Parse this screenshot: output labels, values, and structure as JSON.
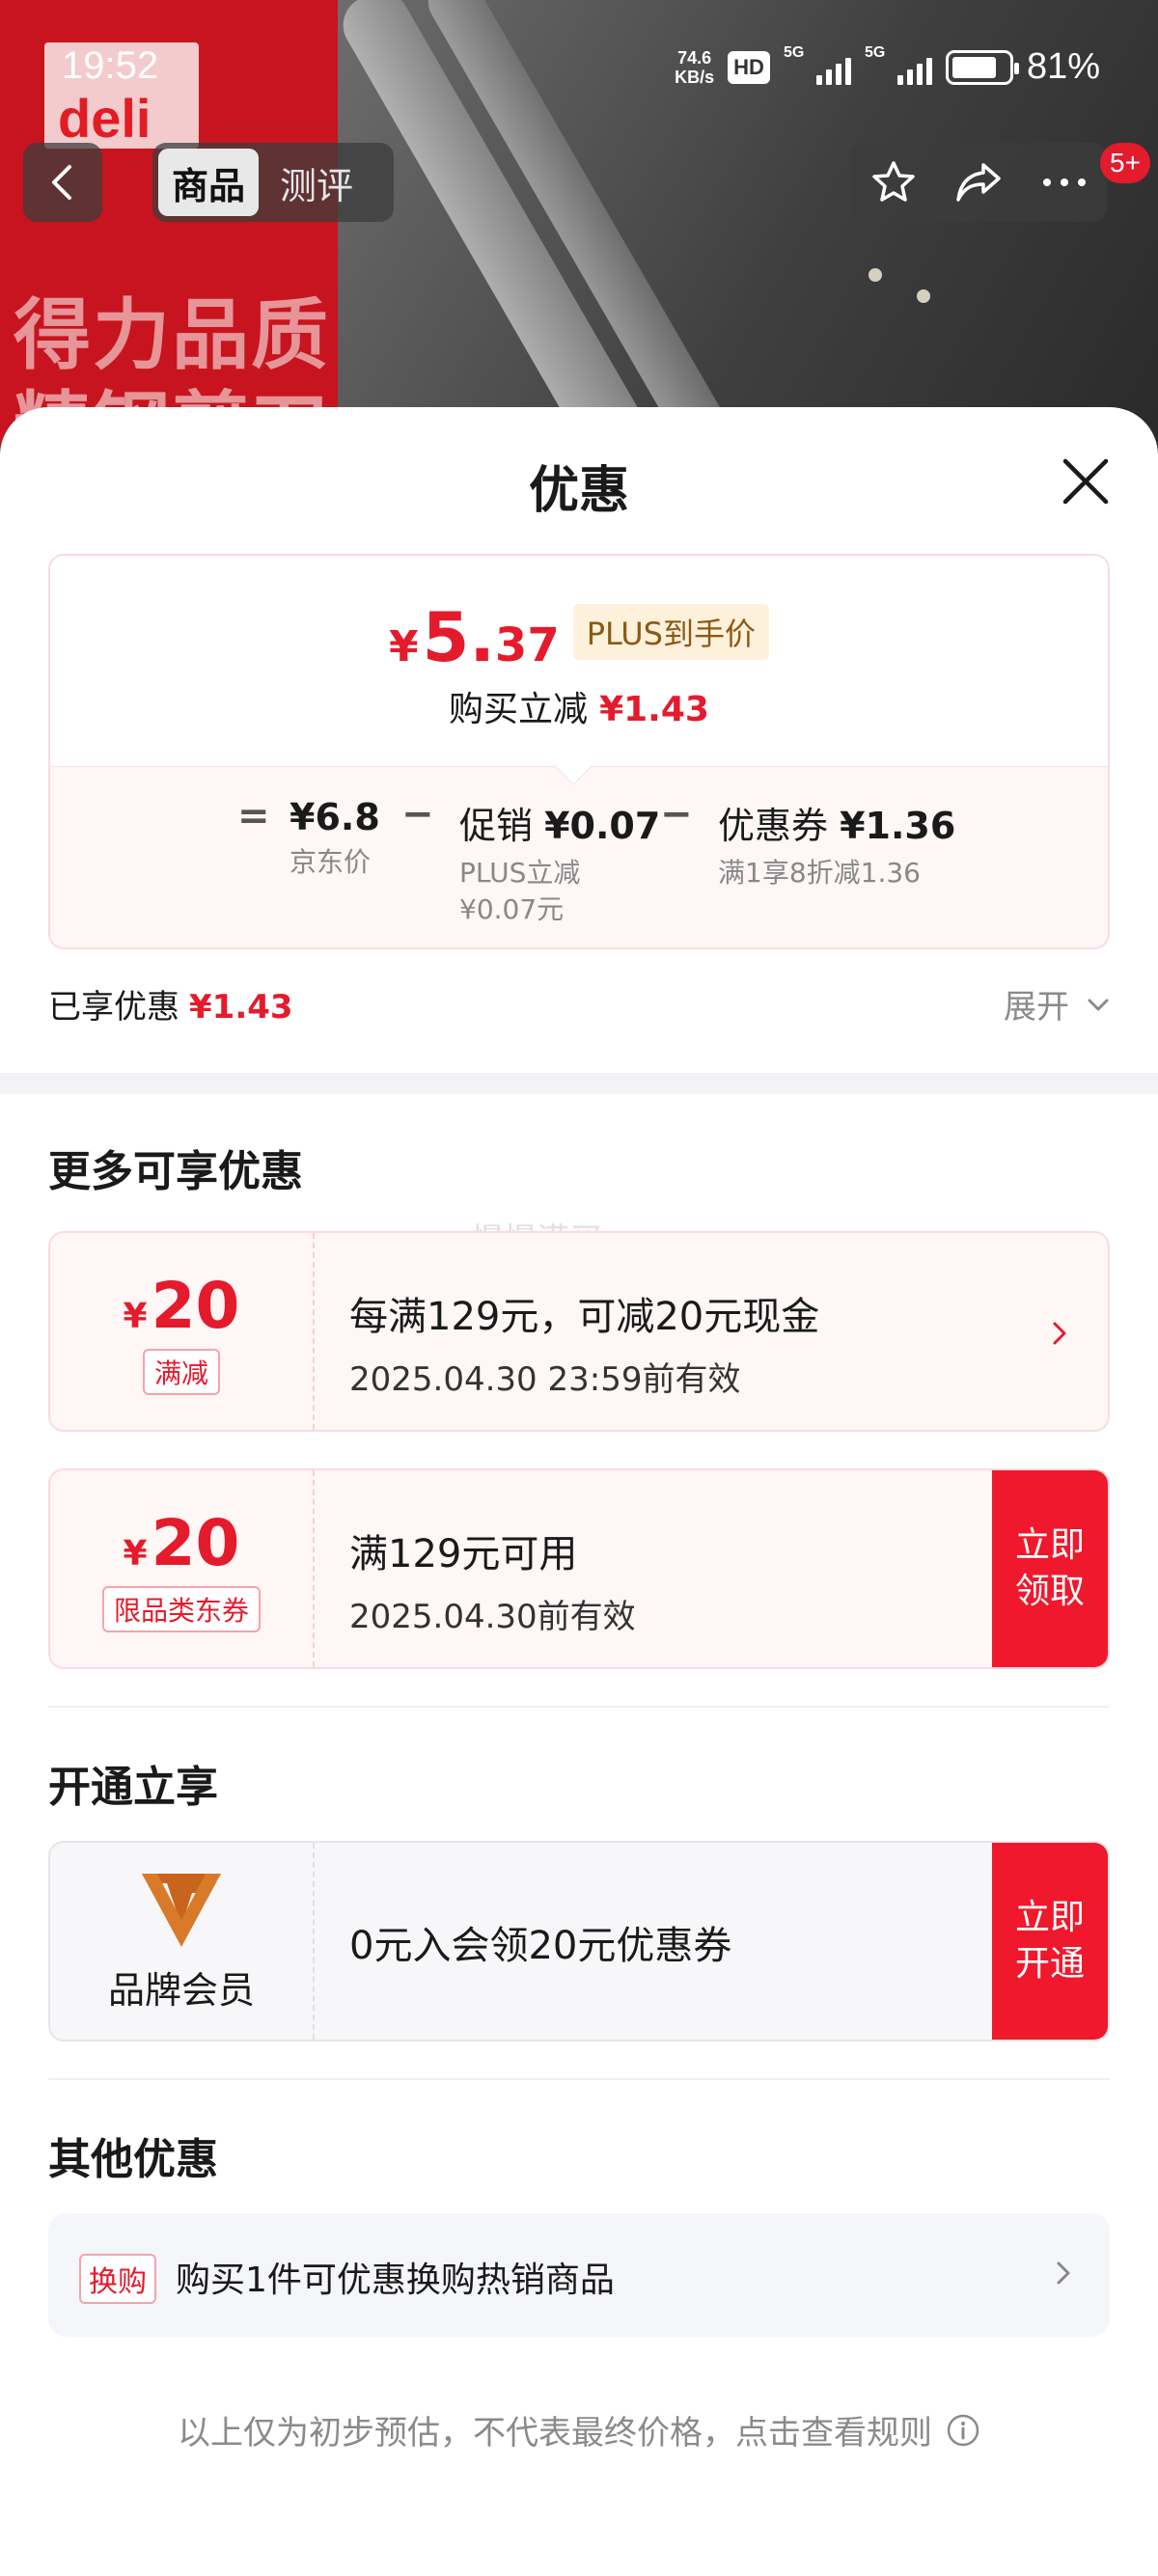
{
  "status_bar": {
    "time": "19:52",
    "net_speed_value": "74.6",
    "net_speed_unit": "KB/s",
    "hd_label": "HD",
    "sig1_label": "5G",
    "sig2_label": "5G",
    "battery": "81%"
  },
  "background": {
    "brand_logo": "deli",
    "promo_text": "得力品质\n精钢剪刀"
  },
  "nav": {
    "tabs": [
      {
        "label": "商品",
        "active": true
      },
      {
        "label": "测评",
        "active": false
      }
    ],
    "badge": "5+"
  },
  "sheet": {
    "title": "优惠"
  },
  "price_card": {
    "currency": "¥",
    "final_int": "5.",
    "final_dec": "37",
    "plus_tag": "PLUS到手价",
    "instant_label": "购买立减",
    "instant_value": "¥1.43",
    "eq": "=",
    "minus": "−",
    "items": [
      {
        "main_label": "",
        "main_value": "¥6.8",
        "sub": "京东价"
      },
      {
        "main_label": "促销",
        "main_value": "¥0.07",
        "sub": "PLUS立减\n¥0.07元"
      },
      {
        "main_label": "优惠券",
        "main_value": "¥1.36",
        "sub": "满1享8折减1.36"
      }
    ]
  },
  "applied": {
    "label": "已享优惠",
    "value": "¥1.43",
    "expand": "展开"
  },
  "more": {
    "title": "更多可享优惠",
    "watermark": "慢慢满买",
    "coupons": [
      {
        "currency": "¥",
        "amount": "20",
        "tag": "满减",
        "line1": "每满129元，可减20元现金",
        "line2": "2025.04.30 23:59前有效",
        "cta": ""
      },
      {
        "currency": "¥",
        "amount": "20",
        "tag": "限品类东券",
        "line1": "满129元可用",
        "line2": "2025.04.30前有效",
        "cta_line1": "立即",
        "cta_line2": "领取"
      }
    ]
  },
  "open": {
    "title": "开通立享",
    "member_label": "品牌会员",
    "member_text": "0元入会领20元优惠券",
    "cta_line1": "立即",
    "cta_line2": "开通"
  },
  "other": {
    "title": "其他优惠",
    "tag": "换购",
    "text": "购买1件可优惠换购热销商品"
  },
  "disclaimer": "以上仅为初步预估，不代表最终价格，点击查看规则",
  "colors": {
    "accent_red": "#e41b2c",
    "cta_red": "#f0182c",
    "plus_gold_bg": "#fdf1dc",
    "brand_orange": "#d2691e"
  }
}
